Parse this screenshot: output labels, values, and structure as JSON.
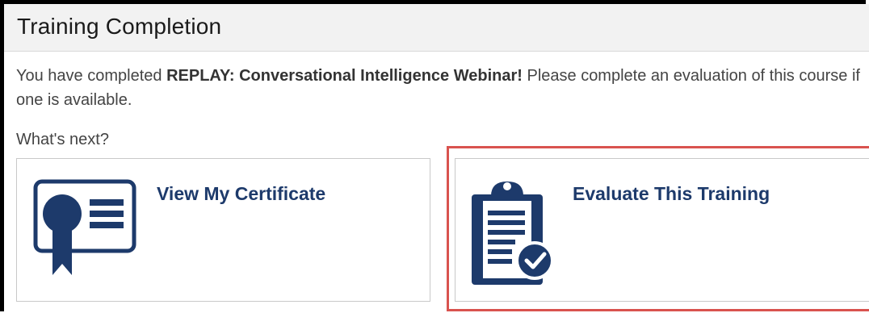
{
  "header": {
    "title": "Training Completion"
  },
  "message": {
    "prefix": "You have completed ",
    "course_name": "REPLAY: Conversational Intelligence Webinar!",
    "suffix": " Please complete an evaluation of this course if one is available."
  },
  "whats_next": {
    "label": "What's next?"
  },
  "cards": {
    "certificate": {
      "label": "View My Certificate",
      "icon": "certificate-icon"
    },
    "evaluate": {
      "label": "Evaluate This Training",
      "icon": "clipboard-check-icon"
    }
  },
  "colors": {
    "brand": "#1d3a6b",
    "highlight": "#d9534f",
    "header_bg": "#f2f2f2"
  }
}
